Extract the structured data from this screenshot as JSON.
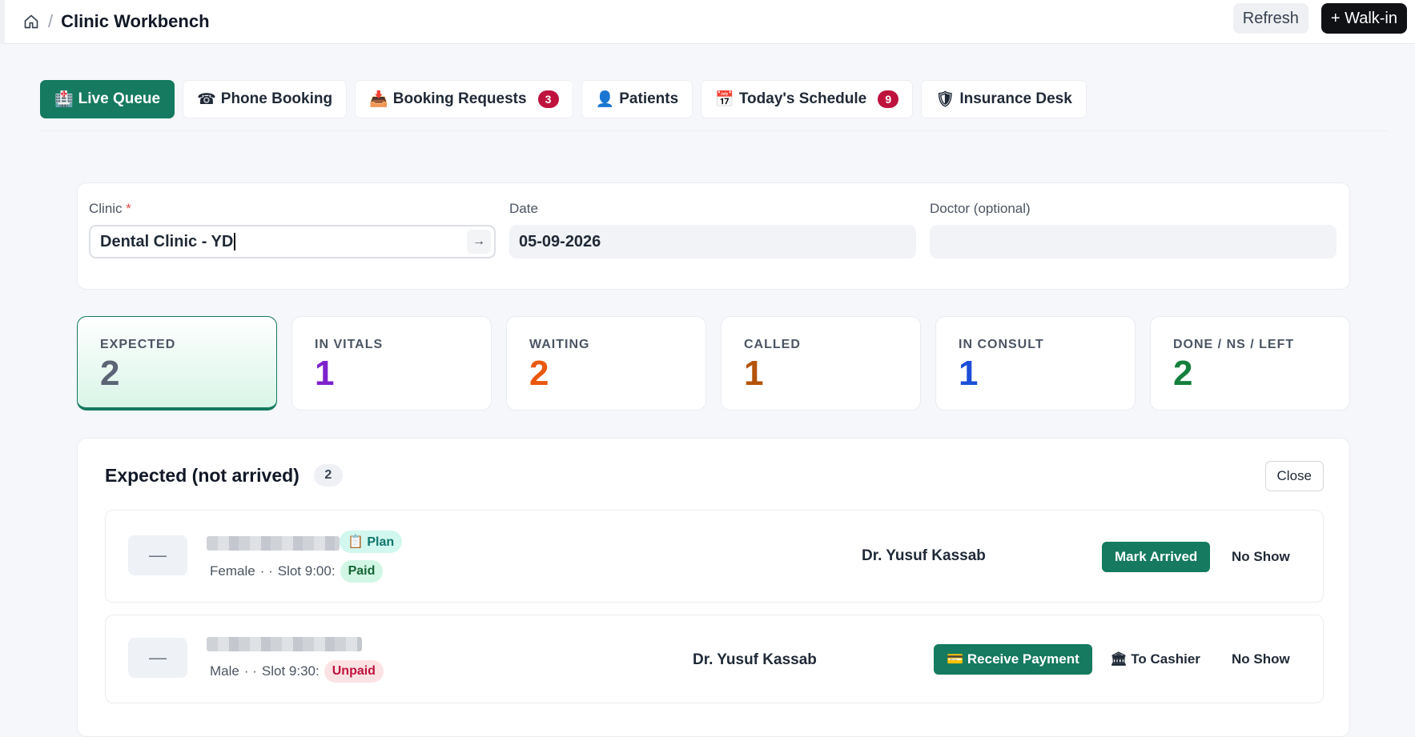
{
  "header": {
    "title": "Clinic Workbench",
    "separator": "/",
    "refresh_label": "Refresh",
    "walkin_label": "+ Walk-in"
  },
  "tabs": [
    {
      "icon": "🏥",
      "label": "Live Queue",
      "badge": null,
      "active": true
    },
    {
      "icon": "☎",
      "label": "Phone Booking",
      "badge": null,
      "active": false
    },
    {
      "icon": "📥",
      "label": "Booking Requests",
      "badge": "3",
      "active": false
    },
    {
      "icon": "👤",
      "label": "Patients",
      "badge": null,
      "active": false
    },
    {
      "icon": "📅",
      "label": "Today's Schedule",
      "badge": "9",
      "active": false
    },
    {
      "icon": "🛡",
      "label": "Insurance Desk",
      "badge": null,
      "active": false
    }
  ],
  "filters": {
    "clinic_label": "Clinic",
    "clinic_required": "*",
    "clinic_value": "Dental Clinic - YD",
    "date_label": "Date",
    "date_value": "05-09-2026",
    "doctor_label": "Doctor (optional)",
    "doctor_value": ""
  },
  "stats": [
    {
      "label": "EXPECTED",
      "value": "2",
      "color": "#5b6475",
      "active": true
    },
    {
      "label": "IN VITALS",
      "value": "1",
      "color": "#7e22ce",
      "active": false
    },
    {
      "label": "WAITING",
      "value": "2",
      "color": "#ea580c",
      "active": false
    },
    {
      "label": "CALLED",
      "value": "1",
      "color": "#b45309",
      "active": false
    },
    {
      "label": "IN CONSULT",
      "value": "1",
      "color": "#1d4ed8",
      "active": false
    },
    {
      "label": "DONE / NS / LEFT",
      "value": "2",
      "color": "#15803d",
      "active": false
    }
  ],
  "expected_list": {
    "title": "Expected (not arrived)",
    "count": "2",
    "close_label": "Close",
    "rows": [
      {
        "avatar": "—",
        "plan_label": "📋 Plan",
        "gender": "Female",
        "separators": "· ·",
        "slot": "Slot 9:00:",
        "payment_status": "Paid",
        "doctor": "Dr. Yusuf Kassab",
        "mark_arrived_label": "Mark Arrived",
        "no_show_label": "No Show"
      },
      {
        "avatar": "—",
        "gender": "Male",
        "separators": "· ·",
        "slot": "Slot 9:30:",
        "payment_status": "Unpaid",
        "doctor": "Dr. Yusuf Kassab",
        "receive_payment_label": "💳 Receive Payment",
        "to_cashier_label": "🏛 To Cashier",
        "no_show_label": "No Show"
      }
    ]
  }
}
